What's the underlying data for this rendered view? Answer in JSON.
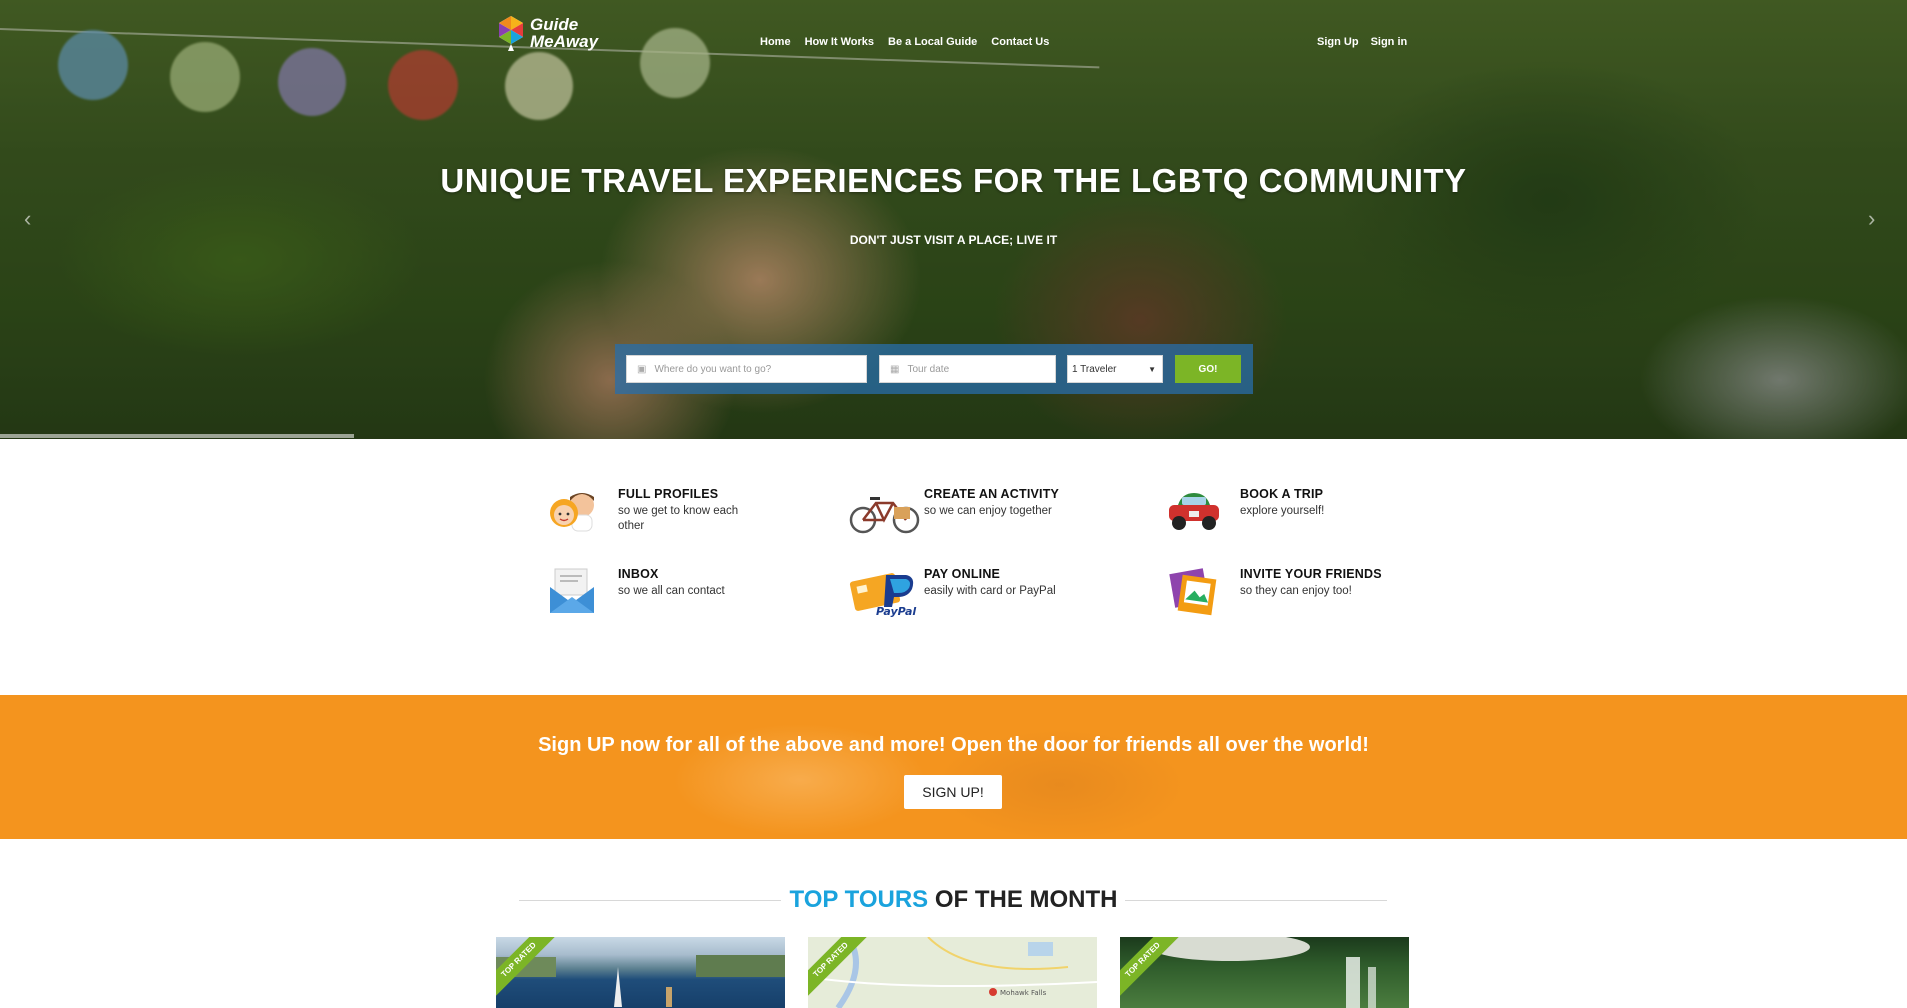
{
  "header": {
    "logo_line1": "Guide",
    "logo_line2": "MeAway",
    "nav": [
      "Home",
      "How It Works",
      "Be a Local Guide",
      "Contact Us"
    ],
    "auth": [
      "Sign Up",
      "Sign in"
    ]
  },
  "hero": {
    "title": "UNIQUE TRAVEL EXPERIENCES FOR THE LGBTQ COMMUNITY",
    "subtitle": "DON'T JUST VISIT A PLACE; LIVE IT",
    "search": {
      "where_placeholder": "Where do you want to go?",
      "date_placeholder": "Tour date",
      "travelers_value": "1 Traveler",
      "go_label": "GO!"
    }
  },
  "features": [
    {
      "icon": "profiles-icon",
      "title": "FULL PROFILES",
      "desc": "so we get to know each other"
    },
    {
      "icon": "bicycle-icon",
      "title": "CREATE AN ACTIVITY",
      "desc": "so we can enjoy together"
    },
    {
      "icon": "car-icon",
      "title": "BOOK A TRIP",
      "desc": "explore yourself!"
    },
    {
      "icon": "inbox-icon",
      "title": "INBOX",
      "desc": "so we all can contact"
    },
    {
      "icon": "paypal-icon",
      "title": "PAY ONLINE",
      "desc": "easily with card or PayPal"
    },
    {
      "icon": "photos-icon",
      "title": "INVITE YOUR FRIENDS",
      "desc": "so they can enjoy too!"
    }
  ],
  "cta": {
    "text": "Sign UP now for all of the above and more! Open the door for friends all over the world!",
    "button": "SIGN UP!"
  },
  "tours": {
    "title_accent": "TOP TOURS",
    "title_rest": " OF THE MONTH",
    "ribbon": "TOP RATED",
    "map_label": "Mohawk Falls"
  },
  "colors": {
    "accent_green": "#7cb526",
    "accent_blue": "#1aa3dd",
    "cta_orange": "#f4941e",
    "search_blue": "#286eaa"
  }
}
